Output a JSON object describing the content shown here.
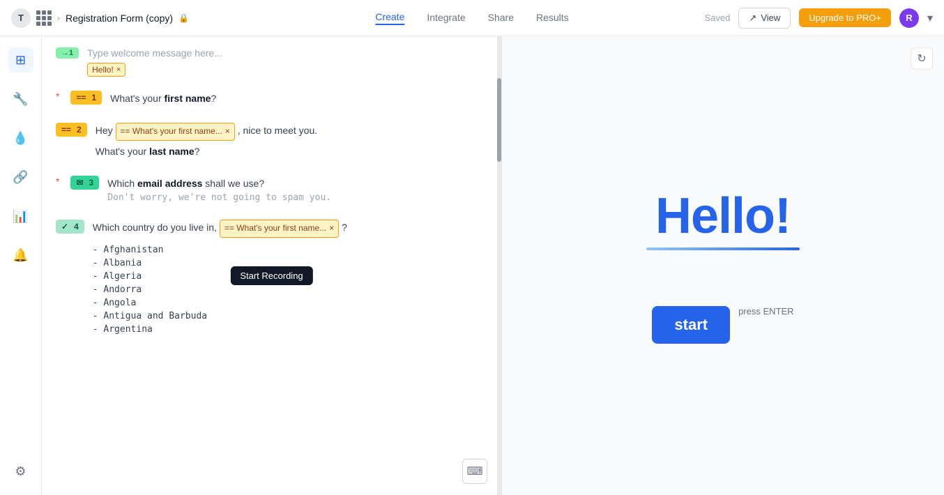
{
  "topnav": {
    "form_title": "Registration Form (copy)",
    "tabs": [
      "Create",
      "Integrate",
      "Share",
      "Results"
    ],
    "active_tab": "Create",
    "saved_label": "Saved",
    "view_label": "View",
    "upgrade_label": "Upgrade to PRO+",
    "avatar_initial": "R"
  },
  "sidebar": {
    "icons": [
      "layout",
      "wrench",
      "droplet",
      "share",
      "calculator",
      "bell",
      "gear"
    ]
  },
  "welcome": {
    "badge_label": "→1",
    "placeholder": "Type welcome message here...",
    "tag_label": "Hello!",
    "tag_x": "×"
  },
  "questions": [
    {
      "id": 1,
      "required": true,
      "badge_type": "short",
      "badge_label": "==",
      "number": "1",
      "text_before": "What's your ",
      "text_bold": "first name",
      "text_after": "?"
    },
    {
      "id": 2,
      "required": false,
      "badge_type": "short",
      "badge_label": "==",
      "number": "2",
      "intro": "Hey ",
      "ref_tag": "== What's your first name... ×",
      "text_after": ", nice to meet you.",
      "second_line_before": "What's your ",
      "second_bold": "last name",
      "second_after": "?"
    },
    {
      "id": 3,
      "required": true,
      "badge_type": "email",
      "badge_label": "✉",
      "number": "3",
      "text_before": "Which ",
      "text_bold": "email address",
      "text_after": " shall we use?",
      "subtext": "Don't worry, we're not going to spam you."
    },
    {
      "id": 4,
      "required": false,
      "badge_type": "dropdown",
      "badge_label": "✓",
      "number": "4",
      "text_before": "Which country do you live in, ",
      "ref_tag": "== What's your first name... ×",
      "text_after": "?",
      "countries": [
        "Afghanistan",
        "Albania",
        "Algeria",
        "Andorra",
        "Angola",
        "Antigua and Barbuda",
        "Argentina"
      ]
    }
  ],
  "tooltip": {
    "label": "Start Recording"
  },
  "preview": {
    "hello_text": "Hello!",
    "start_label": "start",
    "press_enter": "press ENTER"
  },
  "keyboard_icon": "⌨"
}
